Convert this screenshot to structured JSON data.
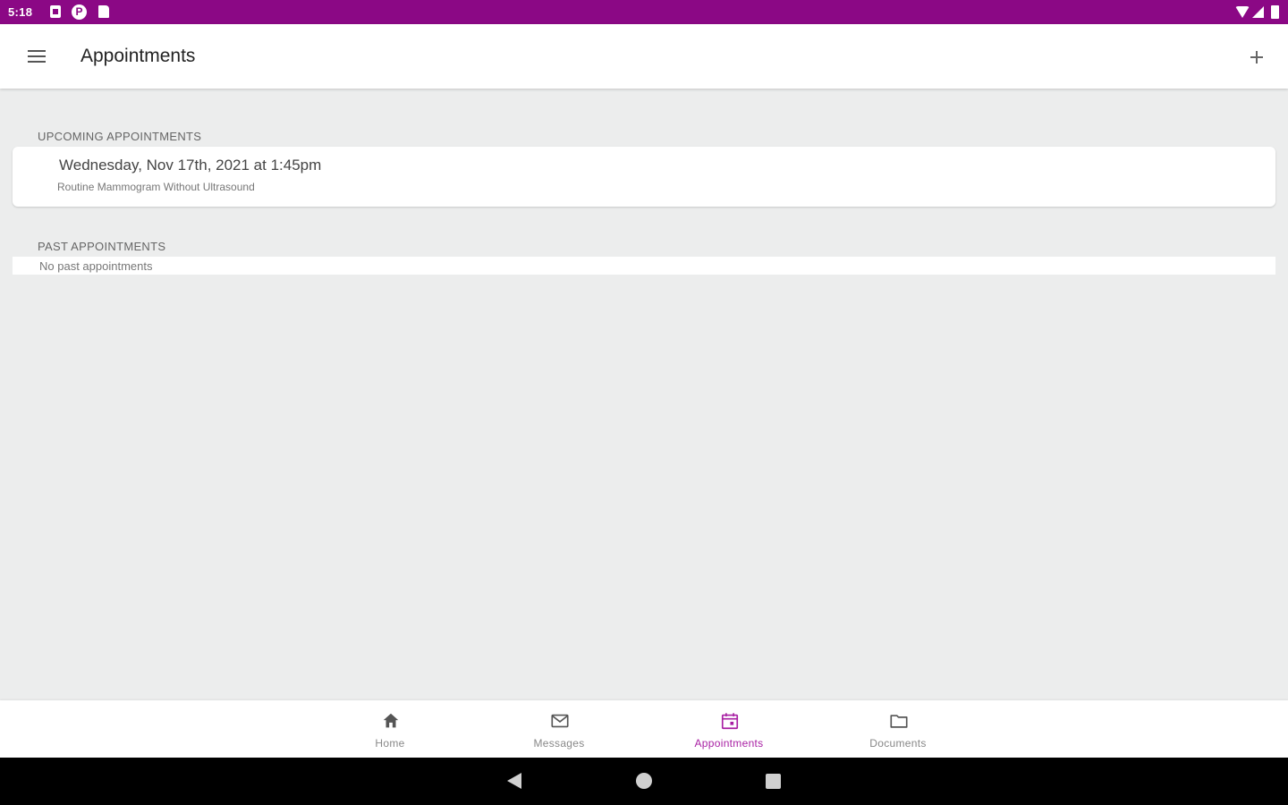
{
  "status_bar": {
    "time": "5:18",
    "background": "#8b0885"
  },
  "app_bar": {
    "title": "Appointments",
    "menu_icon": "hamburger-menu-icon",
    "action_icon": "plus-icon"
  },
  "upcoming": {
    "header": "UPCOMING APPOINTMENTS",
    "items": [
      {
        "date": "Wednesday, Nov 17th, 2021 at 1:45pm",
        "description": "Routine Mammogram Without Ultrasound"
      }
    ]
  },
  "past": {
    "header": "PAST APPOINTMENTS",
    "empty_text": "No past appointments"
  },
  "bottom_nav": {
    "active_color": "#a81fa3",
    "items": [
      {
        "label": "Home",
        "icon": "home-icon"
      },
      {
        "label": "Messages",
        "icon": "envelope-icon"
      },
      {
        "label": "Appointments",
        "icon": "calendar-icon"
      },
      {
        "label": "Documents",
        "icon": "folder-icon"
      }
    ]
  }
}
